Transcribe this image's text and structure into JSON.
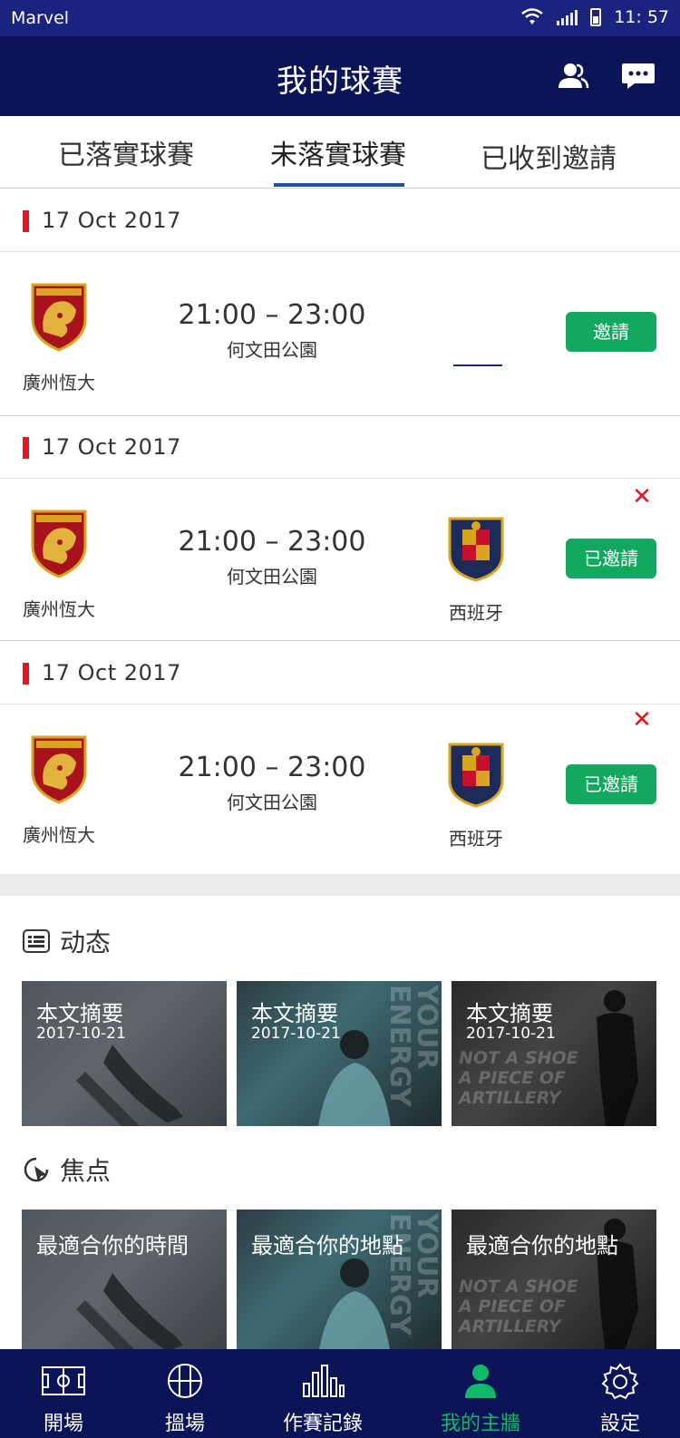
{
  "status_bar": {
    "carrier": "Marvel",
    "time": "11: 57"
  },
  "header": {
    "title": "我的球賽",
    "people_icon": "users-icon",
    "message_icon": "chat-icon"
  },
  "tabs": [
    {
      "label": "已落實球賽",
      "active": false
    },
    {
      "label": "未落實球賽",
      "active": true
    },
    {
      "label": "已收到邀請",
      "active": false
    }
  ],
  "matches": [
    {
      "date": "17 Oct 2017",
      "home": {
        "name": "廣州恆大"
      },
      "time": "21:00 – 23:00",
      "venue": "何文田公園",
      "away": null,
      "button": "邀請",
      "closable": false
    },
    {
      "date": "17 Oct 2017",
      "home": {
        "name": "廣州恆大"
      },
      "time": "21:00 – 23:00",
      "venue": "何文田公園",
      "away": {
        "name": "西班牙"
      },
      "button": "已邀請",
      "closable": true
    },
    {
      "date": "17 Oct 2017",
      "home": {
        "name": "廣州恆大"
      },
      "time": "21:00 – 23:00",
      "venue": "何文田公園",
      "away": {
        "name": "西班牙"
      },
      "button": "已邀請",
      "closable": true
    }
  ],
  "close_symbol": "✕",
  "dynamics": {
    "title": "动态",
    "cards": [
      {
        "title": "本文摘要",
        "date": "2017-10-21"
      },
      {
        "title": "本文摘要",
        "date": "2017-10-21"
      },
      {
        "title": "本文摘要",
        "date": "2017-10-21"
      }
    ]
  },
  "focus": {
    "title": "焦点",
    "cards": [
      {
        "title": "最適合你的時間"
      },
      {
        "title": "最適合你的地點"
      },
      {
        "title": "最適合你的地點"
      }
    ]
  },
  "card_deco": {
    "energy": "YOUR ENERGY",
    "shoe_1": "NOT A SHOE",
    "shoe_2": "A PIECE OF ARTILLERY"
  },
  "bottom_nav": [
    {
      "label": "開場",
      "icon": "pitch-icon",
      "active": false
    },
    {
      "label": "搵場",
      "icon": "ball-icon",
      "active": false
    },
    {
      "label": "作賽記錄",
      "icon": "stats-icon",
      "active": false
    },
    {
      "label": "我的主牆",
      "icon": "person-icon",
      "active": true
    },
    {
      "label": "設定",
      "icon": "gear-icon",
      "active": false
    }
  ],
  "colors": {
    "nav_bg": "#0a1456",
    "accent_green": "#12a860",
    "tab_underline": "#1f4fa5",
    "date_marker": "#e8161c"
  }
}
